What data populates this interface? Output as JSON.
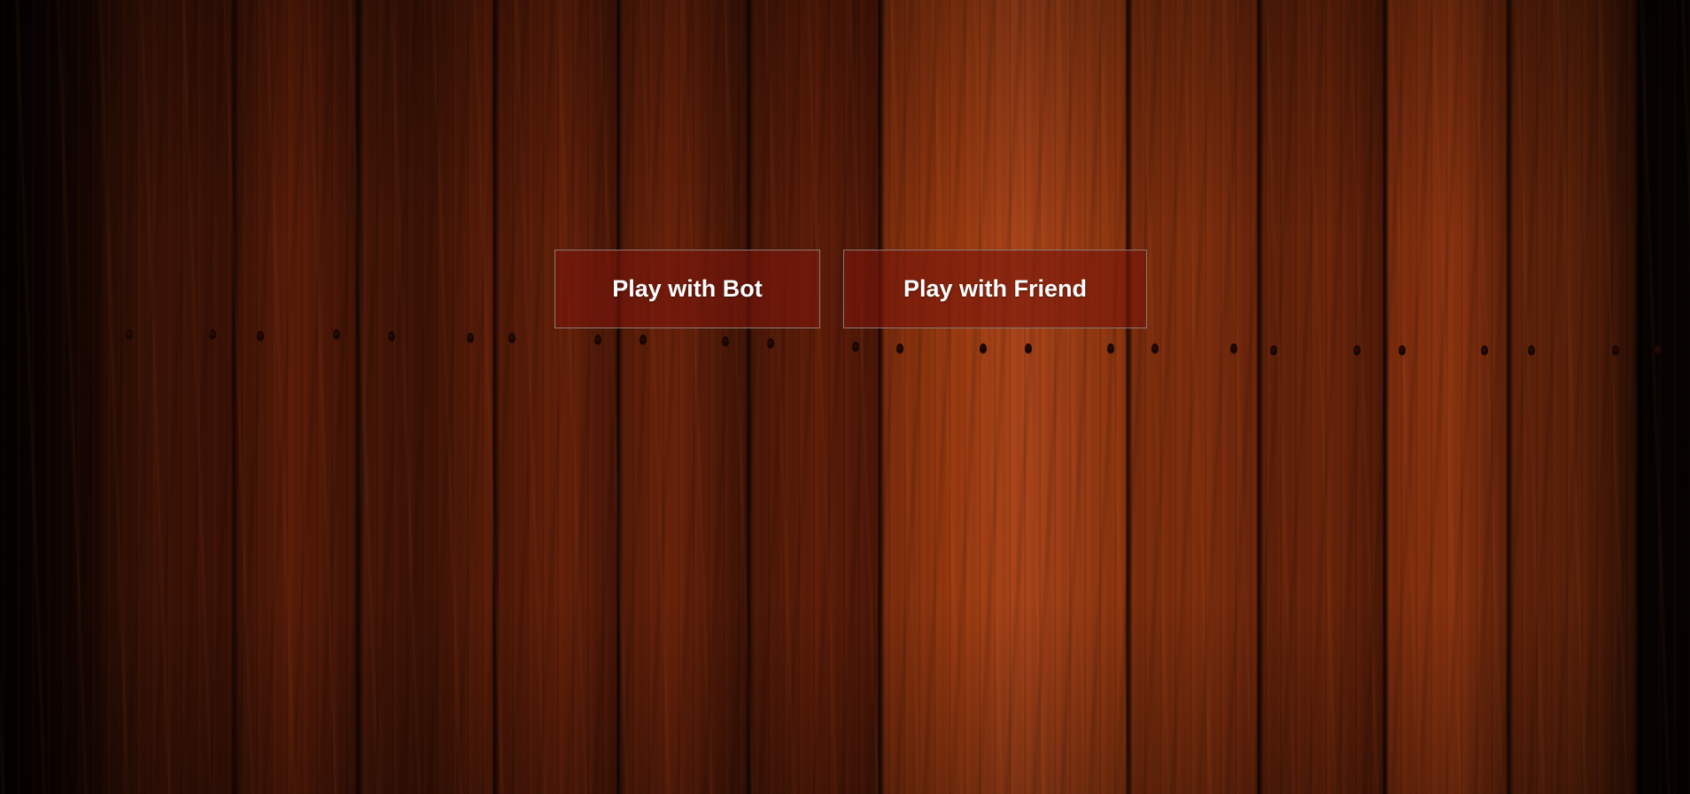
{
  "menu": {
    "play_bot_label": "Play with Bot",
    "play_friend_label": "Play with Friend"
  },
  "colors": {
    "button_background": "#7a160c",
    "button_border": "#8a7a74",
    "button_text": "#ffffff",
    "wood_dark": "#2a0c03",
    "wood_light": "#a9441a"
  }
}
